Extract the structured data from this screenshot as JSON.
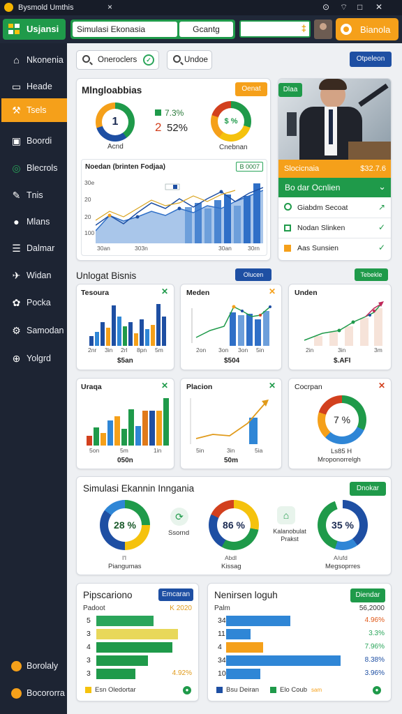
{
  "window": {
    "title": "Bysmold Umthis",
    "close": "×",
    "controls": [
      "⊙",
      "⌔",
      "□",
      "✕"
    ]
  },
  "topbar": {
    "app_label": "Usjansi",
    "search_value": "Simulasi Ekonasia",
    "search_button": "Gcantg",
    "field_icon": "‡",
    "action_label": "Bianola"
  },
  "sidebar": {
    "items": [
      {
        "label": "Nkonenia",
        "icon": "home-icon"
      },
      {
        "label": "Heade",
        "icon": "monitor-icon"
      },
      {
        "label": "Tsels",
        "icon": "tools-icon",
        "active": true
      },
      {
        "label": "Boordi",
        "icon": "car-icon"
      },
      {
        "label": "Blecrols",
        "icon": "gauge-icon"
      },
      {
        "label": "Tnis",
        "icon": "chart-icon"
      },
      {
        "label": "Mlans",
        "icon": "eye-icon"
      },
      {
        "label": "Dalmar",
        "icon": "list-icon"
      },
      {
        "label": "Widan",
        "icon": "compass-icon"
      },
      {
        "label": "Pocka",
        "icon": "palette-icon"
      },
      {
        "label": "Samodan",
        "icon": "gear-icon"
      },
      {
        "label": "Yolgrd",
        "icon": "globe-icon"
      }
    ],
    "bottom": [
      {
        "label": "Borolaly",
        "icon": "coin-icon"
      },
      {
        "label": "Bocororra",
        "icon": "coin-icon"
      }
    ]
  },
  "toolbar": {
    "pill1": "Oneroclers",
    "pill2": "Undoe",
    "button": "Otpeleon"
  },
  "overview": {
    "title": "Mlngloabbias",
    "badge": "Oenat",
    "donut1_value": "1",
    "donut1_label": "Acnd",
    "stat1": "7.3%",
    "stat2_num": "2",
    "stat2_pct": "52%",
    "donut2_value": "$ %",
    "donut2_label": "Cnebnan",
    "chart_title": "Noedan (brinten Fodjaa)",
    "chart_badge": "B 0007",
    "x_ticks": [
      "30an",
      "303n",
      "30an",
      "30rn"
    ],
    "y_ticks": [
      "30e",
      "20",
      "20",
      "100"
    ]
  },
  "photo_card": {
    "badge": "Dlaa",
    "banner_label": "Slocicnaia",
    "banner_value": "$32.7.6",
    "dropdown": "Bo dar Ocnlien",
    "rows": [
      {
        "label": "Giabdm Secoat",
        "icon": "arrow-icon"
      },
      {
        "label": "Nodan Slinken",
        "icon": "check-icon"
      },
      {
        "label": "Aas Sunsien",
        "icon": "check-icon"
      }
    ]
  },
  "section2": {
    "title": "Unlogat Bisnis",
    "btn_blue": "Olucen",
    "btn_green": "Tebekle"
  },
  "mini_cards": [
    {
      "title": "Tesoura",
      "footer": "$5an",
      "x_ticks": [
        "2nr",
        "3in",
        "2rl",
        "8pn",
        "5m"
      ]
    },
    {
      "title": "Meden",
      "footer": "$504",
      "x_ticks": [
        "2on",
        "3on",
        "3on",
        "5in"
      ]
    },
    {
      "title": "Unden",
      "footer": "$.AFI",
      "x_ticks": [
        "2in",
        "3in",
        "3m"
      ]
    },
    {
      "title": "Uraqa",
      "footer": "050n",
      "x_ticks": [
        "5on",
        "5m",
        "1in"
      ]
    },
    {
      "title": "Placion",
      "footer": "50m",
      "x_ticks": [
        "5in",
        "3in",
        "5ia"
      ]
    },
    {
      "title": "Cocrpan",
      "footer": "Mroponorrelgh",
      "donut_value": "7 %",
      "donut_sub": "Ls85 H"
    }
  ],
  "simulation": {
    "title": "Simulasi Ekannin Inngania",
    "button": "Dnokar",
    "items": [
      {
        "value": "28 %",
        "label": "Piangumas",
        "sub": "I'l"
      },
      {
        "icon_label": "Ssornd"
      },
      {
        "value": "86 %",
        "label": "Kissag",
        "sub": "Abdl"
      },
      {
        "icon_label": "Kalanobulat Prakst"
      },
      {
        "value": "35 %",
        "label": "Megsoprres",
        "sub": "A/ufd"
      }
    ]
  },
  "bottom_left": {
    "title": "Pipscariono",
    "button": "Emcaran",
    "col_left": "Padoot",
    "col_right": "K 2020",
    "rows": [
      {
        "label": "5",
        "value": 0.62,
        "color": "#2aa55a"
      },
      {
        "label": "3",
        "value": 0.88,
        "color": "#e8d85a"
      },
      {
        "label": "4",
        "value": 0.82,
        "color": "#1f9a4a"
      },
      {
        "label": "3",
        "value": 0.56,
        "color": "#1f9a4a"
      },
      {
        "label": "3",
        "value": 0.42,
        "color": "#1f9a4a",
        "pct": "4.92%"
      }
    ],
    "legend": "Esn Oledortar"
  },
  "bottom_right": {
    "title": "Nenirsen loguh",
    "button": "Diendar",
    "col_left": "Palm",
    "col_right": "56,2000",
    "rows": [
      {
        "label": "34",
        "value": 0.52,
        "color": "#2f86d6",
        "pct": "4.96%",
        "pct_color": "#e05a1a"
      },
      {
        "label": "11",
        "value": 0.2,
        "color": "#2f86d6",
        "pct": "3.3%",
        "pct_color": "#2aa55a"
      },
      {
        "label": "4",
        "value": 0.3,
        "color": "#f5a01a",
        "pct": "7.96%",
        "pct_color": "#2aa55a"
      },
      {
        "label": "34",
        "value": 0.93,
        "color": "#2f86d6",
        "pct": "8.38%",
        "pct_color": "#1e4fa3"
      },
      {
        "label": "10",
        "value": 0.28,
        "color": "#2f86d6",
        "pct": "3.96%",
        "pct_color": "#1e4fa3"
      }
    ],
    "legend1": "Bsu Deiran",
    "legend2": "Elo Coub",
    "legend3": "sam"
  },
  "colors": {
    "green": "#1f9a4a",
    "orange": "#f5a01a",
    "blue": "#1e4fa3",
    "navy": "#1d2433"
  }
}
